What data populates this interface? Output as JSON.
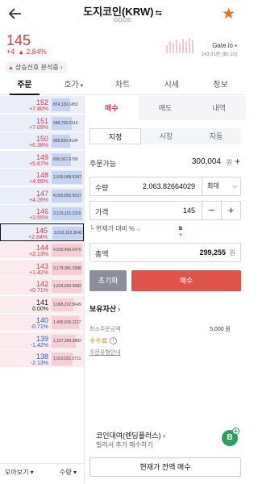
{
  "header": {
    "title": "도지코인(KRW)",
    "title_swap_icon": "⇆",
    "ticker": "DOGE",
    "back_icon": "arrow-left-icon",
    "favorite_icon": "star-icon",
    "favorite_color": "#f26b16"
  },
  "price": {
    "current": "145",
    "change_abs": "+4",
    "change_pct": "2.84%",
    "color_up": "#e8363f",
    "color_down": "#1f5bd8"
  },
  "exchange": {
    "name": "Gate.io",
    "sub": "143.31원 ($0.10)"
  },
  "signal": {
    "label": "상승신호 분석중"
  },
  "main_tabs": [
    {
      "label": "주문",
      "active": true
    },
    {
      "label": "호가",
      "dropdown": true
    },
    {
      "label": "차트"
    },
    {
      "label": "시세"
    },
    {
      "label": "정보"
    }
  ],
  "orderbook": [
    {
      "side": "ask",
      "price": "152",
      "rate": "+7.80%",
      "qty": "874,139.1453",
      "dir": "up",
      "depth": 0.6
    },
    {
      "side": "ask",
      "price": "151",
      "rate": "+7.09%",
      "qty": "948,709.2314",
      "dir": "up",
      "depth": 0.65
    },
    {
      "side": "ask",
      "price": "150",
      "rate": "+6.38%",
      "qty": "868,820.4194",
      "dir": "up",
      "depth": 0.6
    },
    {
      "side": "ask",
      "price": "149",
      "rate": "+5.67%",
      "qty": "895,067.6789",
      "dir": "up",
      "depth": 0.62
    },
    {
      "side": "ask",
      "price": "148",
      "rate": "+4.96%",
      "qty": "1,609,098.5347",
      "dir": "up",
      "depth": 1.0
    },
    {
      "side": "ask",
      "price": "147",
      "rate": "+4.26%",
      "qty": "4,065,855.5637",
      "dir": "up",
      "depth": 1.0
    },
    {
      "side": "ask",
      "price": "146",
      "rate": "+3.55%",
      "qty": "3,120,115.2329",
      "dir": "up",
      "depth": 1.0
    },
    {
      "side": "ask",
      "price": "145",
      "rate": "+2.84%",
      "qty": "3,615,103.3542",
      "dir": "up",
      "depth": 1.0,
      "current": true
    },
    {
      "side": "bid",
      "price": "144",
      "rate": "+2.13%",
      "qty": "4,559,406.6476",
      "dir": "up",
      "depth": 1.0
    },
    {
      "side": "bid",
      "price": "143",
      "rate": "+1.42%",
      "qty": "3,178,381.1588",
      "dir": "up",
      "depth": 1.0
    },
    {
      "side": "bid",
      "price": "142",
      "rate": "+0.71%",
      "qty": "1,624,650.9582",
      "dir": "up",
      "depth": 1.0
    },
    {
      "side": "bid",
      "price": "141",
      "rate": "0.00%",
      "qty": "1,068,222.8649",
      "dir": "flat",
      "depth": 0.72
    },
    {
      "side": "bid",
      "price": "140",
      "rate": "-0.71%",
      "qty": "1,465,916.1127",
      "dir": "down",
      "depth": 0.9
    },
    {
      "side": "bid",
      "price": "139",
      "rate": "-1.42%",
      "qty": "1,257,399.3882",
      "dir": "down",
      "depth": 0.8
    },
    {
      "side": "bid",
      "price": "138",
      "rate": "-2.13%",
      "qty": "1,013,551.5711",
      "dir": "down",
      "depth": 0.68
    }
  ],
  "book_footer": {
    "left": "모아보기",
    "right": "수량"
  },
  "order": {
    "sub_tabs": [
      "매수",
      "매도",
      "내역"
    ],
    "types": [
      "지정",
      "시장",
      "자동"
    ],
    "available_label": "주문가능",
    "available_value": "300,004",
    "available_unit": "원",
    "qty_label": "수량",
    "qty_value": "2,063.82664029",
    "qty_select": "최대",
    "price_label": "가격",
    "price_value": "145",
    "vs_prev_label": "현재가 대비 %",
    "total_label": "총액",
    "total_value": "299,255",
    "total_unit": "원",
    "reset_label": "초기화",
    "buy_label": "매수",
    "holdings_label": "보유자산",
    "min_order_label": "최소주문금액",
    "min_order_value": "5,000 원",
    "fee_label": "수수료",
    "order_type_label": "주문유형안내",
    "lending_title": "코인대여(렌딩플러스)",
    "lending_sub": "빌려서 추가 매수하기",
    "lending_badge": "B",
    "buy_now_label": "현재가 전액 매수"
  }
}
